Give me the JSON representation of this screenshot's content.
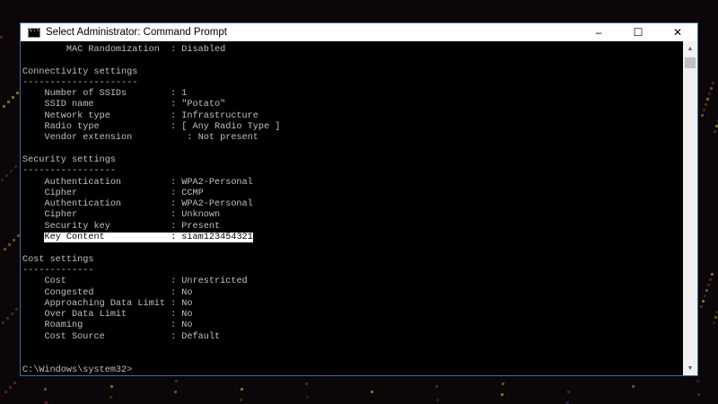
{
  "window": {
    "title": "Select Administrator: Command Prompt",
    "minimize_icon": "–",
    "maximize_icon": "☐",
    "close_icon": "✕"
  },
  "console": {
    "lines": [
      {
        "text": "        MAC Randomization  : Disabled"
      },
      {
        "text": ""
      },
      {
        "text": "Connectivity settings"
      },
      {
        "text": "---------------------"
      },
      {
        "text": "    Number of SSIDs        : 1"
      },
      {
        "text": "    SSID name              : \"Potato\""
      },
      {
        "text": "    Network type           : Infrastructure"
      },
      {
        "text": "    Radio type             : [ Any Radio Type ]"
      },
      {
        "text": "    Vendor extension          : Not present"
      },
      {
        "text": ""
      },
      {
        "text": "Security settings"
      },
      {
        "text": "-----------------"
      },
      {
        "text": "    Authentication         : WPA2-Personal"
      },
      {
        "text": "    Cipher                 : CCMP"
      },
      {
        "text": "    Authentication         : WPA2-Personal"
      },
      {
        "text": "    Cipher                 : Unknown"
      },
      {
        "text": "    Security key           : Present"
      },
      {
        "text": "    Key Content            : siam123454321",
        "highlight": true
      },
      {
        "text": ""
      },
      {
        "text": "Cost settings"
      },
      {
        "text": "-------------"
      },
      {
        "text": "    Cost                   : Unrestricted"
      },
      {
        "text": "    Congested              : No"
      },
      {
        "text": "    Approaching Data Limit : No"
      },
      {
        "text": "    Over Data Limit        : No"
      },
      {
        "text": "    Roaming                : No"
      },
      {
        "text": "    Cost Source            : Default"
      },
      {
        "text": ""
      },
      {
        "text": ""
      },
      {
        "text": "C:\\Windows\\system32>"
      }
    ]
  }
}
